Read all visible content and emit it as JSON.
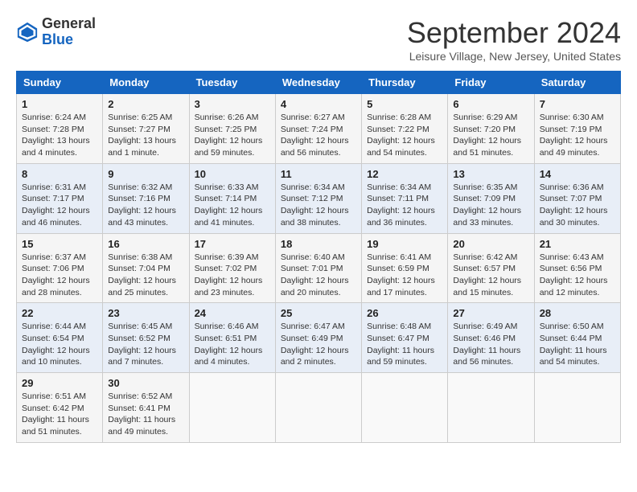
{
  "header": {
    "logo_general": "General",
    "logo_blue": "Blue",
    "month_title": "September 2024",
    "subtitle": "Leisure Village, New Jersey, United States"
  },
  "calendar": {
    "days_of_week": [
      "Sunday",
      "Monday",
      "Tuesday",
      "Wednesday",
      "Thursday",
      "Friday",
      "Saturday"
    ],
    "weeks": [
      [
        {
          "day": "1",
          "info": "Sunrise: 6:24 AM\nSunset: 7:28 PM\nDaylight: 13 hours\nand 4 minutes."
        },
        {
          "day": "2",
          "info": "Sunrise: 6:25 AM\nSunset: 7:27 PM\nDaylight: 13 hours\nand 1 minute."
        },
        {
          "day": "3",
          "info": "Sunrise: 6:26 AM\nSunset: 7:25 PM\nDaylight: 12 hours\nand 59 minutes."
        },
        {
          "day": "4",
          "info": "Sunrise: 6:27 AM\nSunset: 7:24 PM\nDaylight: 12 hours\nand 56 minutes."
        },
        {
          "day": "5",
          "info": "Sunrise: 6:28 AM\nSunset: 7:22 PM\nDaylight: 12 hours\nand 54 minutes."
        },
        {
          "day": "6",
          "info": "Sunrise: 6:29 AM\nSunset: 7:20 PM\nDaylight: 12 hours\nand 51 minutes."
        },
        {
          "day": "7",
          "info": "Sunrise: 6:30 AM\nSunset: 7:19 PM\nDaylight: 12 hours\nand 49 minutes."
        }
      ],
      [
        {
          "day": "8",
          "info": "Sunrise: 6:31 AM\nSunset: 7:17 PM\nDaylight: 12 hours\nand 46 minutes."
        },
        {
          "day": "9",
          "info": "Sunrise: 6:32 AM\nSunset: 7:16 PM\nDaylight: 12 hours\nand 43 minutes."
        },
        {
          "day": "10",
          "info": "Sunrise: 6:33 AM\nSunset: 7:14 PM\nDaylight: 12 hours\nand 41 minutes."
        },
        {
          "day": "11",
          "info": "Sunrise: 6:34 AM\nSunset: 7:12 PM\nDaylight: 12 hours\nand 38 minutes."
        },
        {
          "day": "12",
          "info": "Sunrise: 6:34 AM\nSunset: 7:11 PM\nDaylight: 12 hours\nand 36 minutes."
        },
        {
          "day": "13",
          "info": "Sunrise: 6:35 AM\nSunset: 7:09 PM\nDaylight: 12 hours\nand 33 minutes."
        },
        {
          "day": "14",
          "info": "Sunrise: 6:36 AM\nSunset: 7:07 PM\nDaylight: 12 hours\nand 30 minutes."
        }
      ],
      [
        {
          "day": "15",
          "info": "Sunrise: 6:37 AM\nSunset: 7:06 PM\nDaylight: 12 hours\nand 28 minutes."
        },
        {
          "day": "16",
          "info": "Sunrise: 6:38 AM\nSunset: 7:04 PM\nDaylight: 12 hours\nand 25 minutes."
        },
        {
          "day": "17",
          "info": "Sunrise: 6:39 AM\nSunset: 7:02 PM\nDaylight: 12 hours\nand 23 minutes."
        },
        {
          "day": "18",
          "info": "Sunrise: 6:40 AM\nSunset: 7:01 PM\nDaylight: 12 hours\nand 20 minutes."
        },
        {
          "day": "19",
          "info": "Sunrise: 6:41 AM\nSunset: 6:59 PM\nDaylight: 12 hours\nand 17 minutes."
        },
        {
          "day": "20",
          "info": "Sunrise: 6:42 AM\nSunset: 6:57 PM\nDaylight: 12 hours\nand 15 minutes."
        },
        {
          "day": "21",
          "info": "Sunrise: 6:43 AM\nSunset: 6:56 PM\nDaylight: 12 hours\nand 12 minutes."
        }
      ],
      [
        {
          "day": "22",
          "info": "Sunrise: 6:44 AM\nSunset: 6:54 PM\nDaylight: 12 hours\nand 10 minutes."
        },
        {
          "day": "23",
          "info": "Sunrise: 6:45 AM\nSunset: 6:52 PM\nDaylight: 12 hours\nand 7 minutes."
        },
        {
          "day": "24",
          "info": "Sunrise: 6:46 AM\nSunset: 6:51 PM\nDaylight: 12 hours\nand 4 minutes."
        },
        {
          "day": "25",
          "info": "Sunrise: 6:47 AM\nSunset: 6:49 PM\nDaylight: 12 hours\nand 2 minutes."
        },
        {
          "day": "26",
          "info": "Sunrise: 6:48 AM\nSunset: 6:47 PM\nDaylight: 11 hours\nand 59 minutes."
        },
        {
          "day": "27",
          "info": "Sunrise: 6:49 AM\nSunset: 6:46 PM\nDaylight: 11 hours\nand 56 minutes."
        },
        {
          "day": "28",
          "info": "Sunrise: 6:50 AM\nSunset: 6:44 PM\nDaylight: 11 hours\nand 54 minutes."
        }
      ],
      [
        {
          "day": "29",
          "info": "Sunrise: 6:51 AM\nSunset: 6:42 PM\nDaylight: 11 hours\nand 51 minutes."
        },
        {
          "day": "30",
          "info": "Sunrise: 6:52 AM\nSunset: 6:41 PM\nDaylight: 11 hours\nand 49 minutes."
        },
        {
          "day": "",
          "info": ""
        },
        {
          "day": "",
          "info": ""
        },
        {
          "day": "",
          "info": ""
        },
        {
          "day": "",
          "info": ""
        },
        {
          "day": "",
          "info": ""
        }
      ]
    ]
  }
}
